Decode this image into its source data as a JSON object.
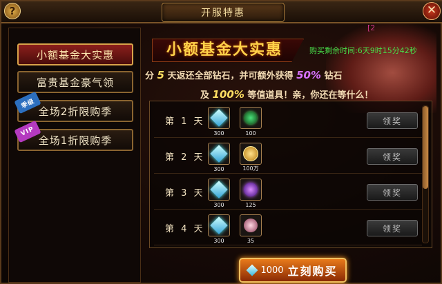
{
  "window": {
    "title": "开服特惠",
    "help": "?",
    "close": "✕"
  },
  "corner_link": "[2",
  "tabs": [
    {
      "label": "小额基金大实惠",
      "active": true
    },
    {
      "label": "富贵基金豪气领",
      "active": false
    },
    {
      "label": "全场2折限购季",
      "active": false,
      "badge": "季级"
    },
    {
      "label": "全场1折限购季",
      "active": false,
      "badge": "VIP"
    }
  ],
  "banner": {
    "title": "小额基金大实惠",
    "countdown": "购买剩余时间:6天9时15分42秒"
  },
  "description": {
    "line1_prefix": "分",
    "line1_days": "5",
    "line1_mid": "天返还全部钻石，并可额外获得",
    "line1_pct": "50%",
    "line1_end": "钻石",
    "line2_prefix": "及",
    "line2_pct": "100%",
    "line2_end": "等值道具！亲，你还在等什么！"
  },
  "rewards": [
    {
      "day": "第 1 天",
      "diamond": "300",
      "item_qty": "100",
      "item_icon": "green-orb-icon",
      "claim": "领奖"
    },
    {
      "day": "第 2 天",
      "diamond": "300",
      "item_qty": "100万",
      "item_icon": "gold-coin-icon",
      "claim": "领奖"
    },
    {
      "day": "第 3 天",
      "diamond": "300",
      "item_qty": "125",
      "item_icon": "purple-orb-icon",
      "claim": "领奖"
    },
    {
      "day": "第 4 天",
      "diamond": "300",
      "item_qty": "35",
      "item_icon": "pink-pearl-icon",
      "claim": "领奖"
    }
  ],
  "buy_button": {
    "price": "1000",
    "label": "立刻购买"
  },
  "colors": {
    "accent_gold": "#ffd24a",
    "countdown_green": "#48e04a",
    "active_tab": "#8c1f1c"
  }
}
